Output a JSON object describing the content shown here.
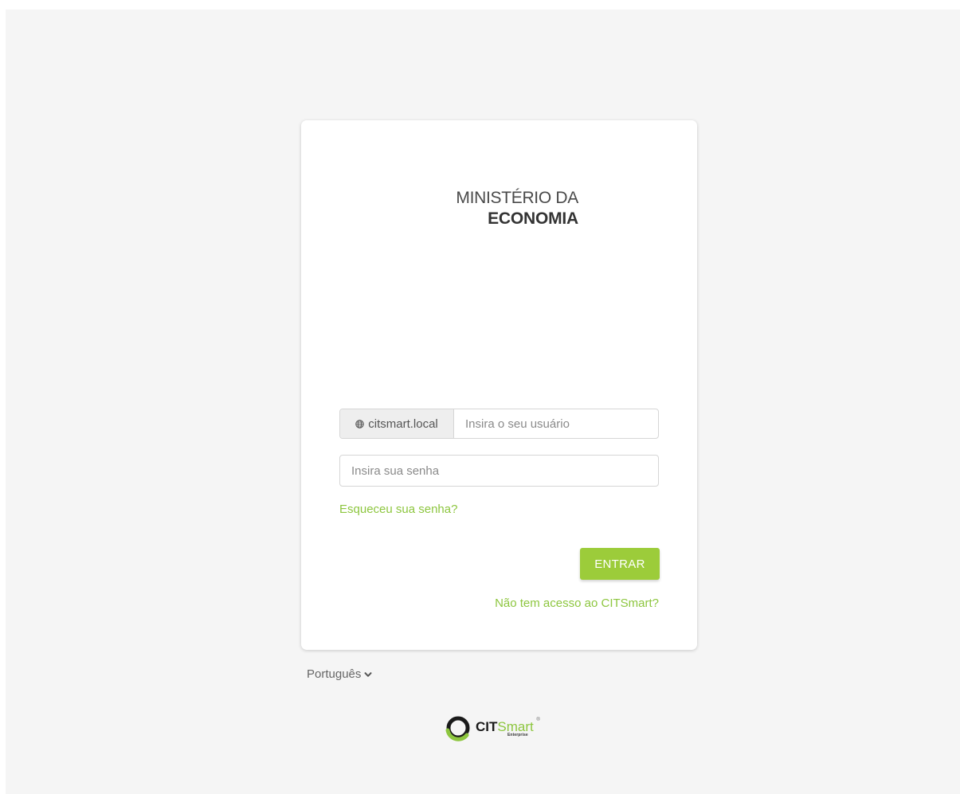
{
  "organization": {
    "line1": "MINISTÉRIO DA",
    "line2": "ECONOMIA"
  },
  "login": {
    "domain_label": "citsmart.local",
    "username_placeholder": "Insira o seu usuário",
    "password_placeholder": "Insira sua senha",
    "forgot_password": "Esqueceu sua senha?",
    "submit_label": "ENTRAR",
    "no_access": "Não tem acesso ao CITSmart?"
  },
  "language": {
    "selected": "Português"
  },
  "brand": {
    "name_part1": "CIT",
    "name_part2": "Smart",
    "subtitle": "Enterprise",
    "registered_mark": "®"
  },
  "colors": {
    "accent": "#8dc63f",
    "button": "#9ccc3a",
    "page_background": "#f5f5f5"
  },
  "icons": {
    "domain": "globe-icon",
    "language": "chevron-down-icon"
  }
}
